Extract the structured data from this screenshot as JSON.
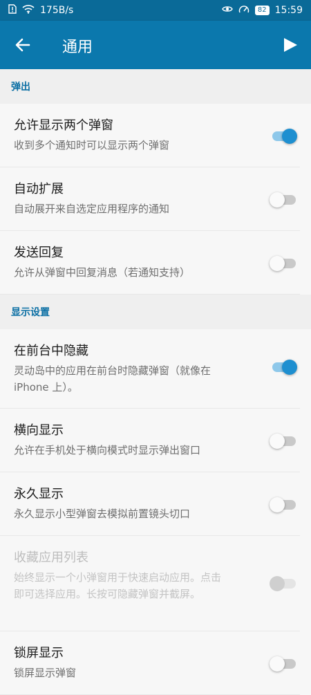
{
  "statusbar": {
    "net_speed": "175B/s",
    "battery": "82",
    "time": "15:59"
  },
  "appbar": {
    "title": "通用"
  },
  "sections": [
    {
      "header": "弹出",
      "rows": [
        {
          "title": "允许显示两个弹窗",
          "subtitle": "收到多个通知时可以显示两个弹窗",
          "on": true
        },
        {
          "title": "自动扩展",
          "subtitle": "自动展开来自选定应用程序的通知",
          "on": false
        },
        {
          "title": "发送回复",
          "subtitle": "允许从弹窗中回复消息（若通知支持）",
          "on": false
        }
      ]
    },
    {
      "header": "显示设置",
      "rows": [
        {
          "title": "在前台中隐藏",
          "subtitle": "灵动岛中的应用在前台时隐藏弹窗（就像在 iPhone 上）。",
          "on": true
        },
        {
          "title": "横向显示",
          "subtitle": "允许在手机处于横向模式时显示弹出窗口",
          "on": false
        },
        {
          "title": "永久显示",
          "subtitle": "永久显示小型弹窗去模拟前置镜头切口",
          "on": false
        },
        {
          "title": "收藏应用列表",
          "subtitle": "始终显示一个小弹窗用于快速启动应用。点击即可选择应用。长按可隐藏弹窗并截屏。",
          "on": false,
          "disabled": true
        },
        {
          "title": "锁屏显示",
          "subtitle": "锁屏显示弹窗",
          "on": false
        }
      ]
    }
  ],
  "colors": {
    "appbar": "#0b78ad",
    "statusbar": "#0a6a98",
    "accent": "#1e8fd0",
    "section_header_text": "#0b6fa4"
  }
}
